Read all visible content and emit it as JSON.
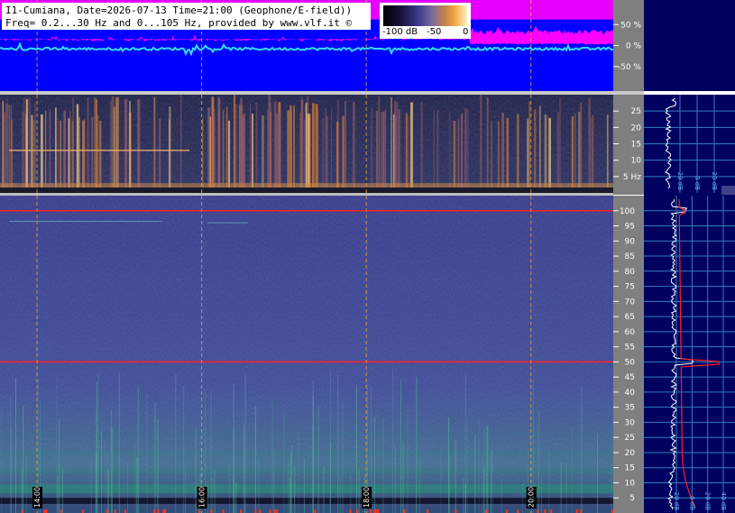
{
  "title": {
    "line1": "I1-Cumiana, Date=2026-07-13 Time=21:00 (Geophone/E-field))",
    "line2": "Freq= 0.2...30 Hz and 0...105 Hz, provided by www.vlf.it ©"
  },
  "colorbar": {
    "ticks": [
      "-100 dB",
      "-50",
      "0"
    ]
  },
  "colors": {
    "accent_magenta": "#ff00ff",
    "waveform_blue": "#0000ff",
    "spectrum_bg": "#000060",
    "spectrogram_low_bg": "#3a3f8c",
    "spectrogram_top_bg": "#20244e",
    "line_red": "#ff2020",
    "time_marker": "#e8a040"
  },
  "chart_data": [
    {
      "type": "line",
      "name": "waveform-strip",
      "y_ticks": [
        "50 %",
        "0 %",
        "-50 %"
      ],
      "y_values": [
        50,
        0,
        -50
      ],
      "ylim": [
        -100,
        100
      ]
    },
    {
      "type": "heatmap",
      "name": "spectrogram-0.2-30hz",
      "y_ticks": [
        "25",
        "20",
        "15",
        "10",
        "5 Hz"
      ],
      "y_values": [
        25,
        20,
        15,
        10,
        5
      ],
      "ylim": [
        0,
        30
      ]
    },
    {
      "type": "heatmap",
      "name": "spectrogram-0-105hz",
      "y_ticks": [
        "100",
        "95",
        "90",
        "85",
        "80",
        "75",
        "70",
        "65",
        "60",
        "55",
        "50",
        "45",
        "40",
        "35",
        "30",
        "25",
        "20",
        "15",
        "10",
        "5"
      ],
      "y_values": [
        100,
        95,
        90,
        85,
        80,
        75,
        70,
        65,
        60,
        55,
        50,
        45,
        40,
        35,
        30,
        25,
        20,
        15,
        10,
        5
      ],
      "ylim": [
        0,
        105
      ],
      "x_ticks": [
        "14:00",
        "16:00",
        "18:00",
        "20:00"
      ],
      "x_hours": [
        14,
        16,
        18,
        20
      ],
      "xlim": [
        13.55,
        21.0
      ],
      "red_lines_hz": [
        50,
        100
      ]
    },
    {
      "type": "line",
      "name": "average-spectrum",
      "x_ticks": [
        "-20 dB",
        "0 dB",
        "20 dB"
      ],
      "x_values": [
        -20,
        0,
        20
      ],
      "lower_x_ticks": [
        "-20 dB",
        "0 dB",
        "20 dB",
        "40 dB"
      ],
      "lower_x_values": [
        -20,
        0,
        20,
        40
      ]
    }
  ]
}
